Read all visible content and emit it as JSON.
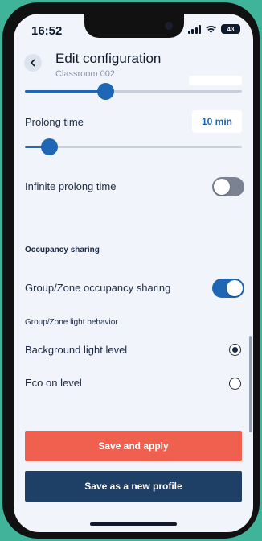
{
  "status_bar": {
    "time": "16:52",
    "battery": "43"
  },
  "header": {
    "title": "Edit configuration",
    "subtitle": "Classroom 002"
  },
  "top_slider": {
    "level": 0.37
  },
  "prolong": {
    "label": "Prolong time",
    "value": "10 min",
    "level": 0.11
  },
  "infinite_prolong": {
    "label": "Infinite prolong time",
    "enabled": false
  },
  "occupancy": {
    "section_title": "Occupancy sharing",
    "sharing_label": "Group/Zone occupancy sharing",
    "sharing_enabled": true,
    "behavior_title": "Group/Zone light behavior",
    "options": [
      {
        "label": "Background light level",
        "selected": true
      },
      {
        "label": "Eco on level",
        "selected": false
      }
    ]
  },
  "buttons": {
    "save_apply": "Save and apply",
    "save_profile": "Save as a new profile"
  },
  "colors": {
    "accent": "#1f66b5",
    "primary_button": "#f0604e",
    "secondary_button": "#1e3f66",
    "background": "#3fb49b"
  }
}
